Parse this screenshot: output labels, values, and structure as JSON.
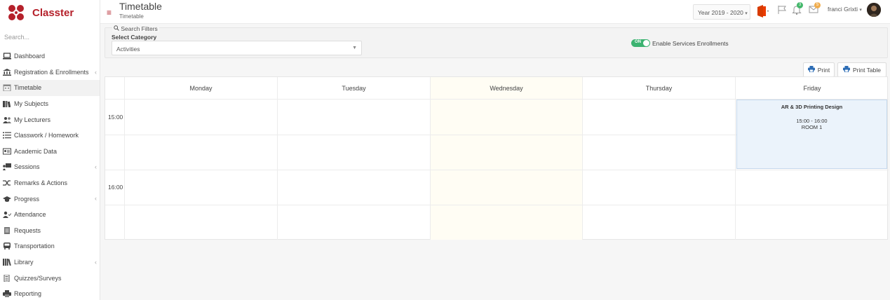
{
  "app": {
    "name": "Classter",
    "brand_color": "#b5212b"
  },
  "sidebar": {
    "search_placeholder": "Search...",
    "items": [
      {
        "label": "Dashboard",
        "icon": "laptop-icon",
        "has_children": false
      },
      {
        "label": "Registration & Enrollments",
        "icon": "institution-icon",
        "has_children": true
      },
      {
        "label": "Timetable",
        "icon": "calendar-icon",
        "has_children": false,
        "active": true
      },
      {
        "label": "My Subjects",
        "icon": "books-icon",
        "has_children": false
      },
      {
        "label": "My Lecturers",
        "icon": "users-icon",
        "has_children": false
      },
      {
        "label": "Classwork / Homework",
        "icon": "list-icon",
        "has_children": false
      },
      {
        "label": "Academic Data",
        "icon": "id-card-icon",
        "has_children": false
      },
      {
        "label": "Sessions",
        "icon": "presentation-icon",
        "has_children": true
      },
      {
        "label": "Remarks & Actions",
        "icon": "shuffle-icon",
        "has_children": false
      },
      {
        "label": "Progress",
        "icon": "graduation-cap-icon",
        "has_children": true
      },
      {
        "label": "Attendance",
        "icon": "user-check-icon",
        "has_children": false
      },
      {
        "label": "Requests",
        "icon": "document-icon",
        "has_children": false
      },
      {
        "label": "Transportation",
        "icon": "bus-icon",
        "has_children": false
      },
      {
        "label": "Library",
        "icon": "library-icon",
        "has_children": true
      },
      {
        "label": "Quizzes/Surveys",
        "icon": "quiz-icon",
        "has_children": false
      },
      {
        "label": "Reporting",
        "icon": "printer-icon",
        "has_children": false
      }
    ]
  },
  "header": {
    "title": "Timetable",
    "breadcrumb": "Timetable",
    "year_label": "Year 2019 - 2020",
    "notifications_count": "3",
    "messages_count": "5",
    "user_name": "franci Grixti"
  },
  "filters": {
    "legend": "Search Filters",
    "category_label": "Select Category",
    "category_value": "Activities",
    "toggle_state": "ON",
    "toggle_label": "Enable Services Enrollments"
  },
  "actions": {
    "print_label": "Print",
    "print_table_label": "Print Table"
  },
  "timetable": {
    "days": [
      "Monday",
      "Tuesday",
      "Wednesday",
      "Thursday",
      "Friday"
    ],
    "highlighted_day": "Wednesday",
    "times": [
      "15:00",
      "16:00"
    ],
    "event": {
      "title": "AR & 3D Printing Design",
      "time": "15:00 - 16:00",
      "room": "ROOM 1",
      "day": "Friday"
    }
  }
}
